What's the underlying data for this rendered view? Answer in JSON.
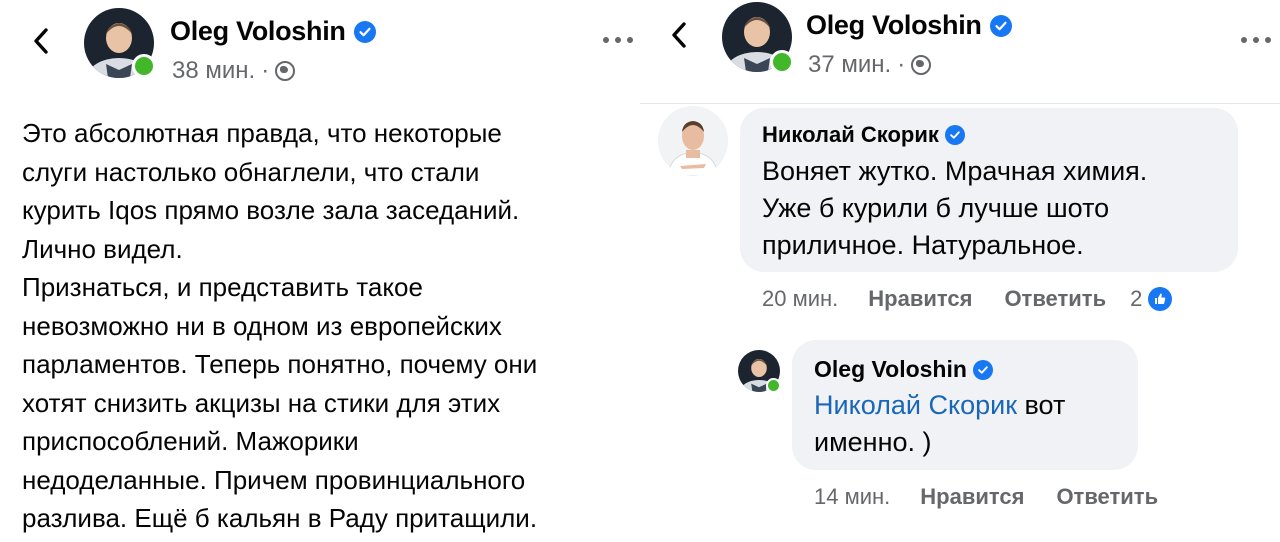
{
  "left": {
    "author": "Oleg Voloshin",
    "time": "38 мин.",
    "separator": "·",
    "body": "Это абсолютная правда, что некоторые\nслуги настолько обнаглели, что стали\nкурить Iqos прямо возле зала заседаний.\nЛично видел.\nПризнаться, и представить такое\nневозможно ни в одном из европейских\nпарламентов. Теперь понятно, почему они\nхотят снизить акцизы на стики для этих\nприспособлений. Мажорики\nнедоделанные. Причем провинциального\nразлива. Ещё б кальян в Раду притащили."
  },
  "right": {
    "author": "Oleg Voloshin",
    "time": "37 мин.",
    "separator": "·",
    "comments": [
      {
        "author": "Николай Скорик",
        "text": "Воняет жутко. Мрачная химия.\nУже б курили б лучше шото\nприличное. Натуральное.",
        "time": "20 мин.",
        "like_label": "Нравится",
        "reply_label": "Ответить",
        "reaction_count": "2"
      },
      {
        "author": "Oleg Voloshin",
        "mention": "Николай Скорик",
        "text": " вот\nименно. )",
        "time": "14 мин.",
        "like_label": "Нравится",
        "reply_label": "Ответить"
      }
    ]
  },
  "icons": {
    "back": "chevron-left-icon",
    "more": "more-horizontal-icon",
    "verified": "verified-badge-icon",
    "privacy": "globe-icon",
    "reaction": "like-thumb-icon"
  },
  "colors": {
    "accent": "#1877f2",
    "mention": "#1a67b8",
    "secondary_text": "#65676b",
    "bubble": "#f0f2f5",
    "online": "#42b72a"
  }
}
